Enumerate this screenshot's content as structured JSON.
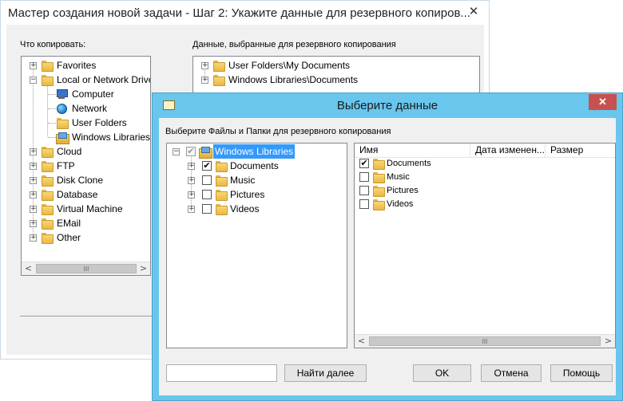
{
  "wizard": {
    "title": "Мастер создания новой задачи - Шаг 2: Укажите данные для резервного копиров...",
    "close_glyph": "✕",
    "what_to_copy_label": "Что копировать:",
    "selected_data_label": "Данные, выбранные для резервного копирования",
    "source_tree": [
      {
        "label": "Favorites"
      },
      {
        "label": "Local or Network Drive"
      },
      {
        "label": "Computer"
      },
      {
        "label": "Network"
      },
      {
        "label": "User Folders"
      },
      {
        "label": "Windows Libraries"
      },
      {
        "label": "Cloud"
      },
      {
        "label": "FTP"
      },
      {
        "label": "Disk Clone"
      },
      {
        "label": "Database"
      },
      {
        "label": "Virtual Machine"
      },
      {
        "label": "EMail"
      },
      {
        "label": "Other"
      }
    ],
    "selected_items": [
      {
        "label": "User Folders\\My Documents"
      },
      {
        "label": "Windows Libraries\\Documents"
      }
    ]
  },
  "dialog": {
    "title": "Выберите данные",
    "close_glyph": "✕",
    "instruction": "Выберите Файлы и Папки для резервного копирования",
    "tree_root": "Windows Libraries",
    "tree_children": [
      {
        "label": "Documents",
        "checked": true
      },
      {
        "label": "Music",
        "checked": false
      },
      {
        "label": "Pictures",
        "checked": false
      },
      {
        "label": "Videos",
        "checked": false
      }
    ],
    "columns": [
      "Имя",
      "Дата изменен...",
      "Размер"
    ],
    "files": [
      {
        "name": "Documents",
        "checked": true
      },
      {
        "name": "Music",
        "checked": false
      },
      {
        "name": "Pictures",
        "checked": false
      },
      {
        "name": "Videos",
        "checked": false
      }
    ],
    "search_value": "",
    "find_next_label": "Найти далее",
    "ok_label": "OK",
    "cancel_label": "Отмена",
    "help_label": "Помощь"
  },
  "scroll": {
    "left": "<",
    "right": ">",
    "grip": "III"
  },
  "glyphs": {
    "plus": "+",
    "minus": "−",
    "check": "✔"
  },
  "colors": {
    "dialog_frame": "#69c6ec",
    "close_red": "#c75050",
    "selection": "#3399ff"
  }
}
